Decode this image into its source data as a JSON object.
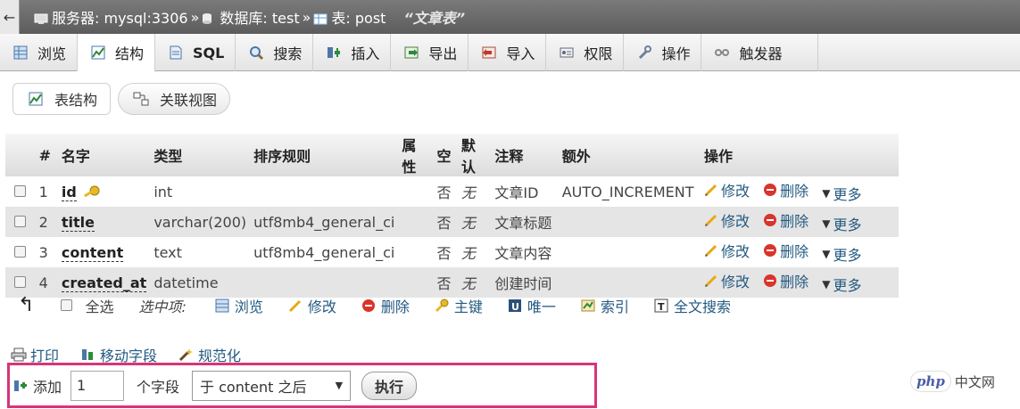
{
  "breadcrumb": {
    "back": "←",
    "server": "服务器: mysql:3306",
    "sep1": "»",
    "database": "数据库: test",
    "sep2": "»",
    "table": "表: post",
    "comment": "“文章表”"
  },
  "tabs": [
    {
      "label": "浏览",
      "icon": "browse-icon"
    },
    {
      "label": "结构",
      "icon": "structure-icon"
    },
    {
      "label": "SQL",
      "icon": "sql-icon"
    },
    {
      "label": "搜索",
      "icon": "search-icon"
    },
    {
      "label": "插入",
      "icon": "insert-icon"
    },
    {
      "label": "导出",
      "icon": "export-icon"
    },
    {
      "label": "导入",
      "icon": "import-icon"
    },
    {
      "label": "权限",
      "icon": "privileges-icon"
    },
    {
      "label": "操作",
      "icon": "operations-icon"
    },
    {
      "label": "触发器",
      "icon": "triggers-icon"
    }
  ],
  "subtabs": {
    "structure": "表结构",
    "relation": "关联视图"
  },
  "table": {
    "headers": [
      "#",
      "名字",
      "类型",
      "排序规则",
      "属性",
      "空",
      "默认",
      "注释",
      "额外",
      "操作"
    ],
    "rows": [
      {
        "num": "1",
        "name": "id",
        "type": "int",
        "collation": "",
        "attrs": "",
        "null": "否",
        "default": "无",
        "comment": "文章ID",
        "extra": "AUTO_INCREMENT"
      },
      {
        "num": "2",
        "name": "title",
        "type": "varchar(200)",
        "collation": "utf8mb4_general_ci",
        "attrs": "",
        "null": "否",
        "default": "无",
        "comment": "文章标题",
        "extra": ""
      },
      {
        "num": "3",
        "name": "content",
        "type": "text",
        "collation": "utf8mb4_general_ci",
        "attrs": "",
        "null": "否",
        "default": "无",
        "comment": "文章内容",
        "extra": ""
      },
      {
        "num": "4",
        "name": "created_at",
        "type": "datetime",
        "collation": "",
        "attrs": "",
        "null": "否",
        "default": "无",
        "comment": "创建时间",
        "extra": ""
      }
    ],
    "actions": {
      "edit": "修改",
      "drop": "删除",
      "more": "更多"
    }
  },
  "bulk": {
    "arrow": "↰",
    "select_all": "全选",
    "with_selected": "选中项:",
    "browse": "浏览",
    "edit": "修改",
    "drop": "删除",
    "primary": "主键",
    "unique": "唯一",
    "index": "索引",
    "fulltext": "全文搜索"
  },
  "links": {
    "print": "打印",
    "move": "移动字段",
    "normalize": "规范化"
  },
  "add_field": {
    "label": "添加",
    "count": "1",
    "unit": "个字段",
    "position": "于 content 之后",
    "go": "执行"
  },
  "watermark": {
    "logo": "php",
    "text": "中文网"
  },
  "colors": {
    "link": "#235a81",
    "highlight_border": "#d9347a",
    "row_alt": "#e5e5e5",
    "drop_red": "#d9342b",
    "edit_yellow": "#e8a814"
  }
}
